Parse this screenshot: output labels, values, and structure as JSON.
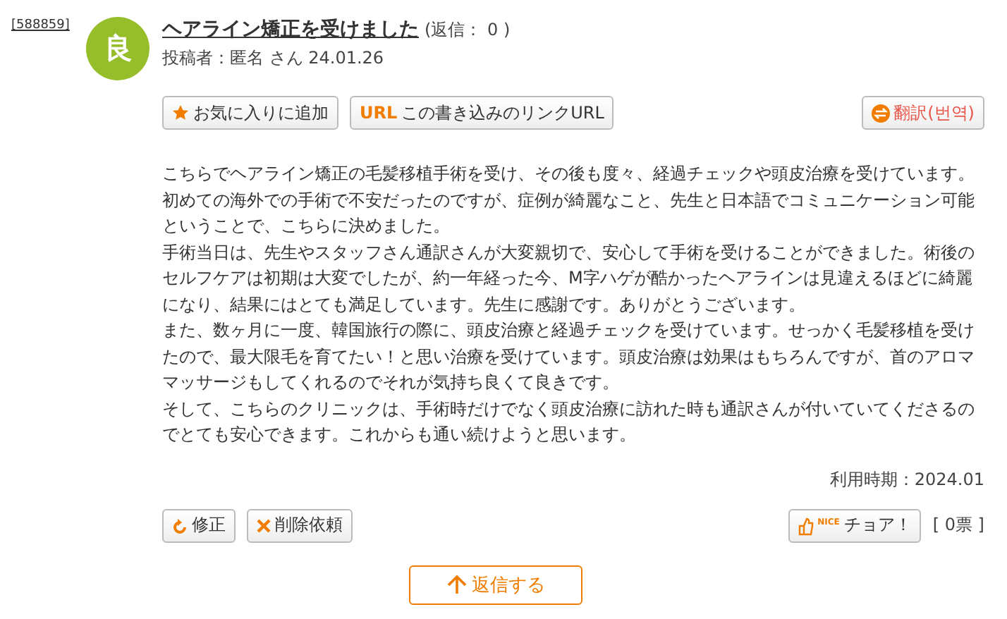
{
  "post_id": "[588859]",
  "avatar": {
    "label": "良",
    "color": "#96bd2a"
  },
  "title": "ヘアライン矯正を受けました",
  "reply_count": "(返信： 0 )",
  "author": "投稿者：匿名 さん 24.01.26",
  "actions": [
    {
      "kind": "favorite",
      "label": "お気に入りに追加"
    },
    {
      "kind": "url",
      "badge": "URL",
      "label": "この書き込みのリンクURL"
    }
  ],
  "translate_button": "翻訳(번역)",
  "body": [
    "こちらでヘアライン矯正の毛髪移植手術を受け、その後も度々、経過チェックや頭皮治療を受けています。",
    "初めての海外での手術で不安だったのですが、症例が綺麗なこと、先生と日本語でコミュニケーション可能ということで、こちらに決めました。",
    "手術当日は、先生やスタッフさん通訳さんが大変親切で、安心して手術を受けることができました。術後のセルフケアは初期は大変でしたが、約一年経った今、M字ハゲが酷かったヘアラインは見違えるほどに綺麗になり、結果にはとても満足しています。先生に感謝です。ありがとうございます。",
    "また、数ヶ月に一度、韓国旅行の際に、頭皮治療と経過チェックを受けています。せっかく毛髪移植を受けたので、最大限毛を育てたい！と思い治療を受けています。頭皮治療は効果はもちろんですが、首のアロママッサージもしてくれるのでそれが気持ち良くて良きです。",
    "そして、こちらのクリニックは、手術時だけでなく頭皮治療に訪れた時も通訳さんが付いていてくださるのでとても安心できます。これからも通い続けようと思います。"
  ],
  "usage_period": "利用時期：2024.01",
  "edit_actions": [
    {
      "kind": "edit",
      "label": "修正"
    },
    {
      "kind": "delete",
      "label": "削除依頼"
    }
  ],
  "cheer_button": {
    "badge": "NICE",
    "label": "チョア！"
  },
  "vote_count": "[ 0票 ]",
  "reply_button": "返信する"
}
